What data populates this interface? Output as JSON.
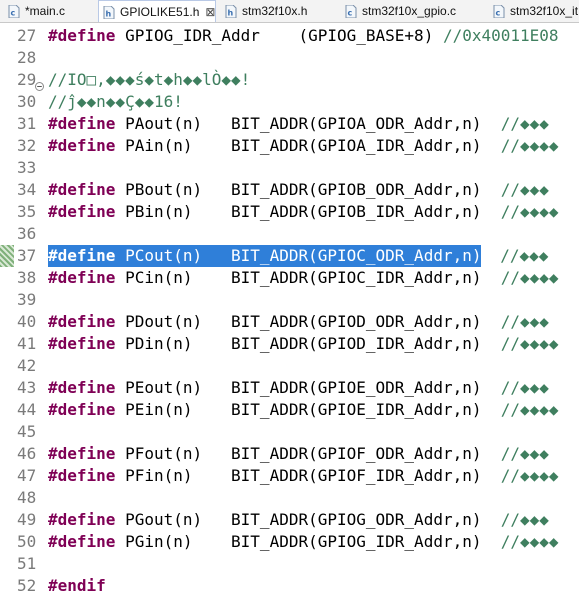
{
  "tabs": [
    {
      "label": "*main.c",
      "icon": "c-file-icon",
      "active": false
    },
    {
      "label": "GPIOLIKE51.h",
      "icon": "h-file-icon",
      "active": true,
      "close": "⊠"
    },
    {
      "label": "stm32f10x.h",
      "icon": "h-file-icon",
      "active": false
    },
    {
      "label": "stm32f10x_gpio.c",
      "icon": "c-file-icon",
      "active": false
    },
    {
      "label": "stm32f10x_it",
      "icon": "c-file-icon",
      "active": false
    }
  ],
  "colors": {
    "keyword": "#7f0055",
    "comment": "#3f7f5f",
    "selection": "#2f7fd9",
    "line_number": "#7a7a7a"
  },
  "lines": [
    {
      "n": "27",
      "kw": "#define",
      "code": " GPIOG_IDR_Addr    (GPIOG_BASE+8) ",
      "comment": "//0x40011E08"
    },
    {
      "n": "28",
      "kw": "",
      "code": "",
      "comment": ""
    },
    {
      "n": "29",
      "kw": "",
      "code": "",
      "comment": "//IO□,◆◆◆ś◆t◆h◆◆lÒ◆◆!",
      "fold": true
    },
    {
      "n": "30",
      "kw": "",
      "code": "",
      "comment": "//ĵ◆◆n◆◆Ç◆◆16!"
    },
    {
      "n": "31",
      "kw": "#define",
      "code": " PAout(n)   BIT_ADDR(GPIOA_ODR_Addr,n)  ",
      "comment": "//◆◆◆"
    },
    {
      "n": "32",
      "kw": "#define",
      "code": " PAin(n)    BIT_ADDR(GPIOA_IDR_Addr,n)  ",
      "comment": "//◆◆◆◆"
    },
    {
      "n": "33",
      "kw": "",
      "code": "",
      "comment": ""
    },
    {
      "n": "34",
      "kw": "#define",
      "code": " PBout(n)   BIT_ADDR(GPIOB_ODR_Addr,n)  ",
      "comment": "//◆◆◆"
    },
    {
      "n": "35",
      "kw": "#define",
      "code": " PBin(n)    BIT_ADDR(GPIOB_IDR_Addr,n)  ",
      "comment": "//◆◆◆◆"
    },
    {
      "n": "36",
      "kw": "",
      "code": "",
      "comment": ""
    },
    {
      "n": "37",
      "kw": "#define",
      "code": " PCout(n)   BIT_ADDR(GPIOC_ODR_Addr,n)",
      "trail": "  ",
      "comment": "//◆◆◆",
      "selected": true
    },
    {
      "n": "38",
      "kw": "#define",
      "code": " PCin(n)    BIT_ADDR(GPIOC_IDR_Addr,n)  ",
      "comment": "//◆◆◆◆"
    },
    {
      "n": "39",
      "kw": "",
      "code": "",
      "comment": ""
    },
    {
      "n": "40",
      "kw": "#define",
      "code": " PDout(n)   BIT_ADDR(GPIOD_ODR_Addr,n)  ",
      "comment": "//◆◆◆"
    },
    {
      "n": "41",
      "kw": "#define",
      "code": " PDin(n)    BIT_ADDR(GPIOD_IDR_Addr,n)  ",
      "comment": "//◆◆◆◆"
    },
    {
      "n": "42",
      "kw": "",
      "code": "",
      "comment": ""
    },
    {
      "n": "43",
      "kw": "#define",
      "code": " PEout(n)   BIT_ADDR(GPIOE_ODR_Addr,n)  ",
      "comment": "//◆◆◆"
    },
    {
      "n": "44",
      "kw": "#define",
      "code": " PEin(n)    BIT_ADDR(GPIOE_IDR_Addr,n)  ",
      "comment": "//◆◆◆◆"
    },
    {
      "n": "45",
      "kw": "",
      "code": "",
      "comment": ""
    },
    {
      "n": "46",
      "kw": "#define",
      "code": " PFout(n)   BIT_ADDR(GPIOF_ODR_Addr,n)  ",
      "comment": "//◆◆◆"
    },
    {
      "n": "47",
      "kw": "#define",
      "code": " PFin(n)    BIT_ADDR(GPIOF_IDR_Addr,n)  ",
      "comment": "//◆◆◆◆"
    },
    {
      "n": "48",
      "kw": "",
      "code": "",
      "comment": ""
    },
    {
      "n": "49",
      "kw": "#define",
      "code": " PGout(n)   BIT_ADDR(GPIOG_ODR_Addr,n)  ",
      "comment": "//◆◆◆"
    },
    {
      "n": "50",
      "kw": "#define",
      "code": " PGin(n)    BIT_ADDR(GPIOG_IDR_Addr,n)  ",
      "comment": "//◆◆◆◆"
    },
    {
      "n": "51",
      "kw": "",
      "code": "",
      "comment": ""
    },
    {
      "n": "52",
      "kw": "#endif",
      "code": "",
      "comment": ""
    }
  ]
}
